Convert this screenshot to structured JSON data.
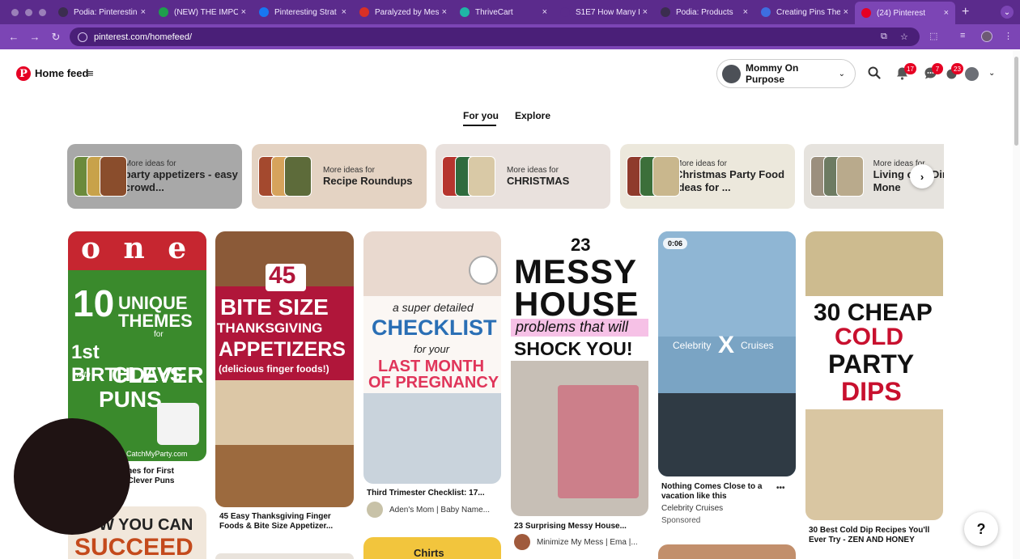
{
  "browser": {
    "tabs": [
      {
        "title": "Podia: Pinterestin",
        "fav": "podia-icon",
        "color": "#3b2d4f"
      },
      {
        "title": "(NEW) THE IMPO",
        "fav": "sheets-icon",
        "color": "#1e9e4c"
      },
      {
        "title": "Pinteresting Strat",
        "fav": "facebook-icon",
        "color": "#1877f2"
      },
      {
        "title": "Paralyzed by Mes",
        "fav": "gmail-icon",
        "color": "#d93025"
      },
      {
        "title": "ThriveCart",
        "fav": "thrivecart-icon",
        "color": "#1fb5a6"
      },
      {
        "title": "S1E7 How Many F",
        "fav": "blank-icon",
        "color": "#5b2b8c"
      },
      {
        "title": "Podia: Products",
        "fav": "podia-icon",
        "color": "#3b2d4f"
      },
      {
        "title": "Creating Pins The",
        "fav": "settings-icon",
        "color": "#3e6ee0"
      },
      {
        "title": "(24) Pinterest",
        "fav": "pinterest-icon",
        "color": "#e60023"
      }
    ],
    "url": "pinterest.com/homefeed/"
  },
  "header": {
    "title": "Home feed",
    "account_name": "Mommy On Purpose",
    "notif_count": "17",
    "messages_count": "7",
    "updates_count": "23"
  },
  "feed_tabs": [
    "For you",
    "Explore"
  ],
  "idea_cards": [
    {
      "small": "More ideas for",
      "big": "party appetizers - easy crowd...",
      "bg": "#a8a8a8"
    },
    {
      "small": "More ideas for",
      "big": "Recipe Roundups",
      "bg": "#e4d3c3"
    },
    {
      "small": "More ideas for",
      "big": "CHRISTMAS",
      "bg": "#e9e1dd"
    },
    {
      "small": "More ideas for",
      "big": "Christmas Party Food Ideas for ...",
      "bg": "#ece8dc"
    },
    {
      "small": "More ideas for",
      "big": "Living on a Dime - Mone",
      "bg": "#e6e3de"
    }
  ],
  "pins": {
    "p1": {
      "line1": "o n e",
      "line2": "10",
      "line3": "UNIQUE",
      "line4": "THEMES",
      "line5": "for",
      "line6": "1st BIRTHDAYS",
      "line7": "with",
      "line8": "CLEVER",
      "line9": "PUNS",
      "site": "CatchMyParty.com",
      "title": "10 Unique Themes for First Birthdays with Clever Puns"
    },
    "p1b": {
      "line1": "HOW YOU CAN",
      "line2": "SUCCEED"
    },
    "p2": {
      "line1": "45",
      "line2": "BITE SIZE",
      "line3": "THANKSGIVING",
      "line4": "APPETIZERS",
      "line5": "(delicious finger foods!)",
      "title": "45 Easy Thanksgiving Finger Foods & Bite Size Appetizer..."
    },
    "p3": {
      "line1": "a super detailed",
      "line2": "CHECKLIST",
      "line3": "for your",
      "line4": "LAST MONTH",
      "line5": "OF PREGNANCY",
      "title": "Third Trimester Checklist: 17...",
      "author": "Aden's Mom | Baby Name..."
    },
    "p3b": {
      "line1": "Chirts"
    },
    "p4": {
      "line1": "23",
      "line2": "MESSY",
      "line3": "HOUSE",
      "line4": "problems that will",
      "line5": "SHOCK YOU!",
      "title": "23 Surprising Messy House...",
      "author": "Minimize My Mess | Ema |..."
    },
    "p5": {
      "duration": "0:06",
      "brand_left": "Celebrity",
      "brand_x": "X",
      "brand_right": "Cruises",
      "title": "Nothing Comes Close to a vacation like this",
      "author": "Celebrity Cruises",
      "sponsored": "Sponsored",
      "more": "•••"
    },
    "p6": {
      "line1": "30 CHEAP",
      "line2": "COLD",
      "line3": "PARTY",
      "line4": "DIPS",
      "title": "30 Best Cold Dip Recipes You'll Ever Try - ZEN AND HONEY"
    }
  },
  "help_label": "?"
}
